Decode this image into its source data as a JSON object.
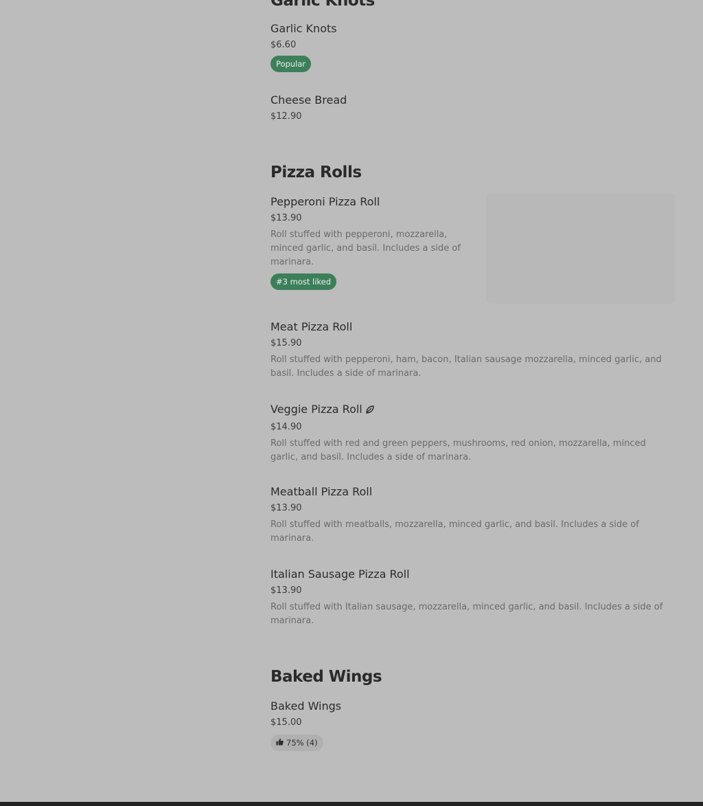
{
  "sections": [
    {
      "title": "Garlic Knots",
      "items": [
        {
          "name": "Garlic Knots",
          "price": "$6.60",
          "badge": "Popular"
        },
        {
          "name": "Cheese Bread",
          "price": "$12.90"
        }
      ]
    },
    {
      "title": "Pizza Rolls",
      "items": [
        {
          "name": "Pepperoni Pizza Roll",
          "price": "$13.90",
          "description": "Roll stuffed with pepperoni, mozzarella, minced garlic, and basil. Includes a side of marinara.",
          "badge": "#3 most liked"
        },
        {
          "name": "Meat Pizza Roll",
          "price": "$15.90",
          "description": "Roll stuffed with pepperoni, ham, bacon, Italian sausage mozzarella, minced garlic, and basil. Includes a side of marinara."
        },
        {
          "name": "Veggie Pizza Roll",
          "price": "$14.90",
          "description": "Roll stuffed with red and green peppers, mushrooms, red onion, mozzarella, minced garlic, and basil. Includes a side of marinara.",
          "icon": "leaf-icon"
        },
        {
          "name": "Meatball Pizza Roll",
          "price": "$13.90",
          "description": "Roll stuffed with meatballs, mozzarella, minced garlic, and basil. Includes a side of marinara."
        },
        {
          "name": "Italian Sausage Pizza Roll",
          "price": "$13.90",
          "description": "Roll stuffed with Italian sausage, mozzarella, minced garlic, and basil. Includes a side of marinara."
        }
      ]
    },
    {
      "title": "Baked Wings",
      "items": [
        {
          "name": "Baked Wings",
          "price": "$15.00",
          "rating": "75% (4)",
          "rating_icon": "thumbs-up-icon"
        }
      ]
    }
  ],
  "colors": {
    "background": "#bcbcbc",
    "badge_green": "#3d7f5a"
  }
}
